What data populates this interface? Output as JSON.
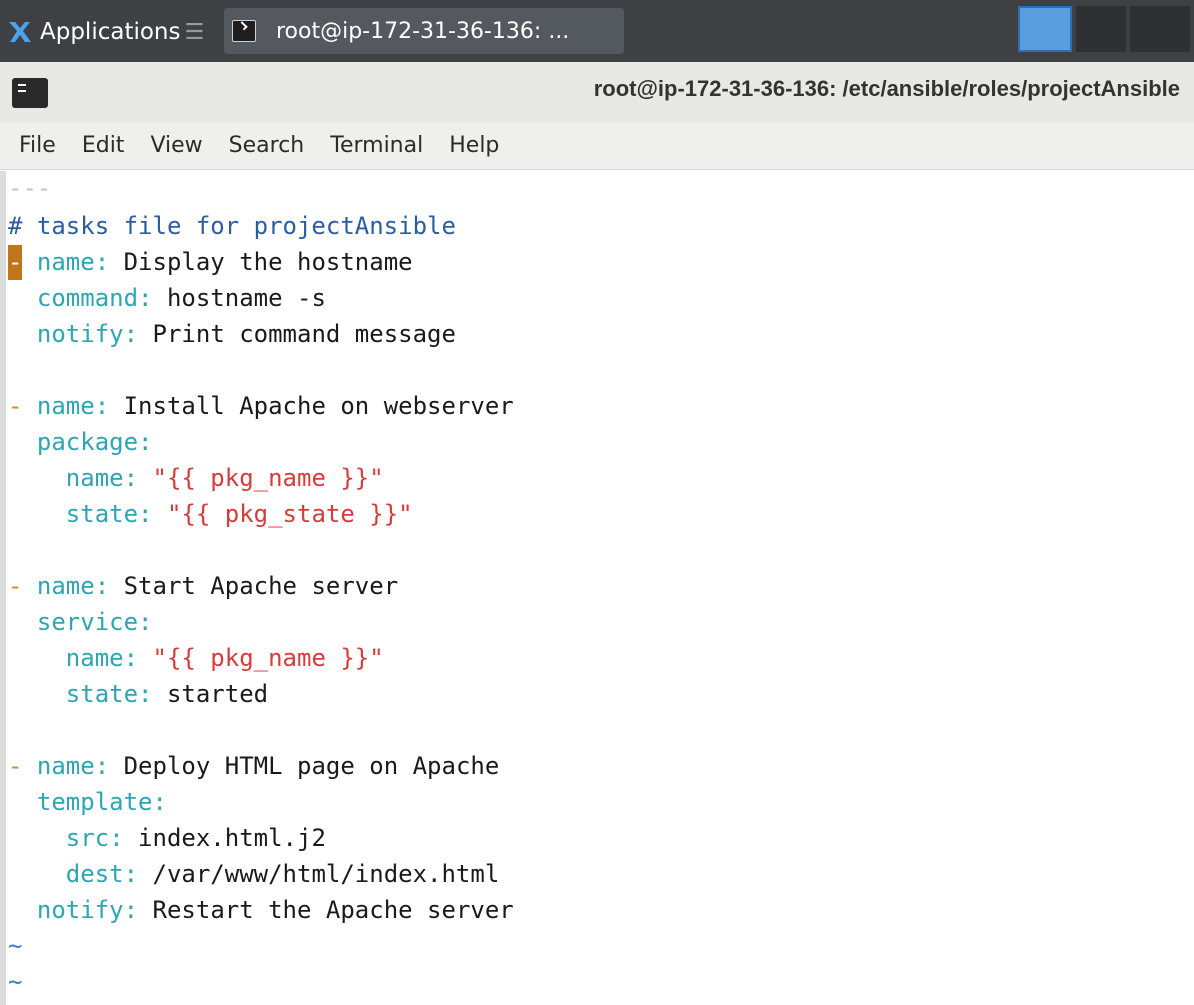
{
  "panel": {
    "apps_label": "Applications",
    "apps_separator": "☰",
    "task_label": "root@ip-172-31-36-136: ..."
  },
  "window": {
    "title": "root@ip-172-31-36-136: /etc/ansible/roles/projectAnsible"
  },
  "menu": {
    "items": [
      "File",
      "Edit",
      "View",
      "Search",
      "Terminal",
      "Help"
    ]
  },
  "editor": {
    "doc_start": "---",
    "comment": "# tasks file for projectAnsible",
    "tilde": "~",
    "tasks": [
      {
        "dash": "-",
        "name_key": "name:",
        "name_value": "Display the hostname",
        "k1": "command:",
        "v1": "hostname -s",
        "k2": "notify:",
        "v2": "Print command message"
      },
      {
        "dash": "-",
        "name_key": "name:",
        "name_value": "Install Apache on webserver",
        "module": "package:",
        "p1_key": "name:",
        "p1_value": "\"{{ pkg_name }}\"",
        "p2_key": "state:",
        "p2_value": "\"{{ pkg_state }}\""
      },
      {
        "dash": "-",
        "name_key": "name:",
        "name_value": "Start Apache server",
        "module": "service:",
        "p1_key": "name:",
        "p1_value": "\"{{ pkg_name }}\"",
        "p2_key": "state:",
        "p2_value": "started"
      },
      {
        "dash": "-",
        "name_key": "name:",
        "name_value": "Deploy HTML page on Apache",
        "module": "template:",
        "p1_key": "src:",
        "p1_value": "index.html.j2",
        "p2_key": "dest:",
        "p2_value": "/var/www/html/index.html",
        "notify_key": "notify:",
        "notify_value": "Restart the Apache server"
      }
    ]
  },
  "colors": {
    "panel_bg": "#3e4044",
    "cursor": "#c1751a",
    "yaml_key": "#2fa5b3",
    "yaml_string": "#d83b3b",
    "comment": "#2a5da3",
    "tilde": "#3a7ad8"
  }
}
